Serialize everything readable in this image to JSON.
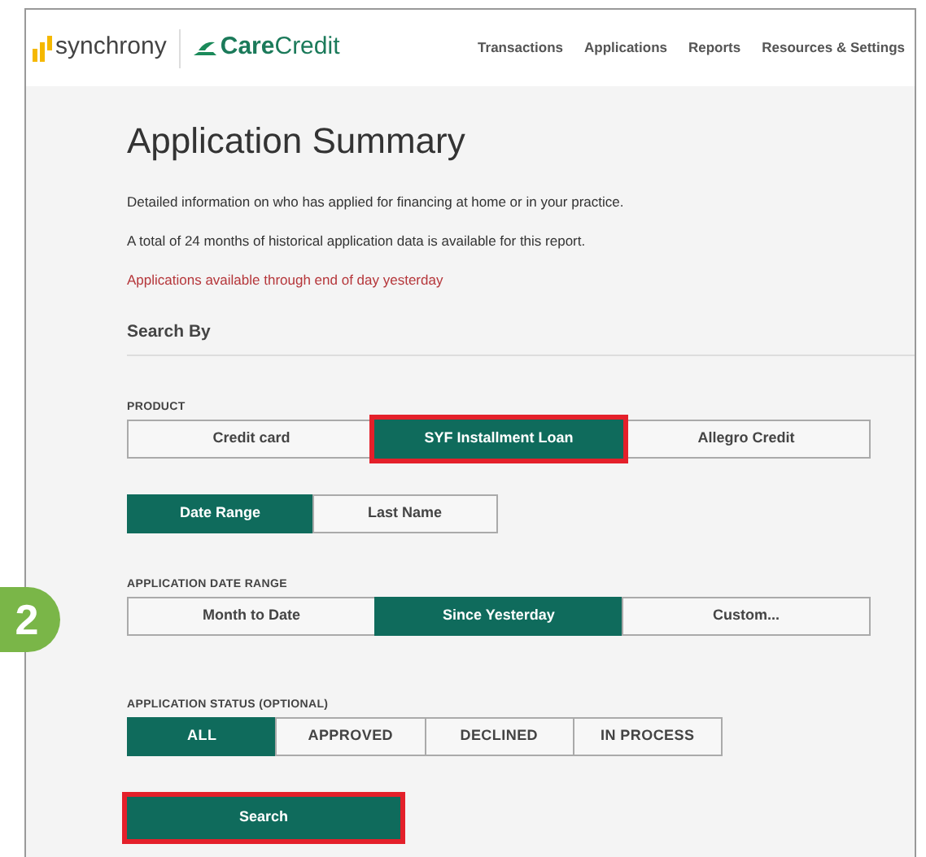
{
  "header": {
    "brand": "synchrony",
    "product_logo": {
      "part_1": "Care",
      "part_2": "Credit"
    },
    "nav": [
      "Transactions",
      "Applications",
      "Reports",
      "Resources & Settings"
    ]
  },
  "title": "Application Summary",
  "intro": [
    "Detailed information on who has applied for financing at home or in your practice.",
    "A total of 24 months of historical application data is available for this report."
  ],
  "notice": "Applications available through end of day yesterday",
  "section": "Search By",
  "step_badge": "2",
  "product": {
    "label": "PRODUCT",
    "options": [
      {
        "label": "Credit card",
        "selected": false,
        "highlighted": false
      },
      {
        "label": "SYF Installment Loan",
        "selected": true,
        "highlighted": true
      },
      {
        "label": "Allegro Credit",
        "selected": false,
        "highlighted": false
      }
    ]
  },
  "search_type": {
    "options": [
      {
        "label": "Date Range",
        "selected": true
      },
      {
        "label": "Last Name",
        "selected": false
      }
    ]
  },
  "date_range": {
    "label": "APPLICATION DATE RANGE",
    "options": [
      {
        "label": "Month to Date",
        "selected": false
      },
      {
        "label": "Since Yesterday",
        "selected": true
      },
      {
        "label": "Custom...",
        "selected": false
      }
    ]
  },
  "status": {
    "label": "APPLICATION STATUS (OPTIONAL)",
    "options": [
      {
        "label": "ALL",
        "selected": true
      },
      {
        "label": "APPROVED",
        "selected": false
      },
      {
        "label": "DECLINED",
        "selected": false
      },
      {
        "label": "IN PROCESS",
        "selected": false
      }
    ]
  },
  "search_button": {
    "label": "Search",
    "highlighted": true
  }
}
